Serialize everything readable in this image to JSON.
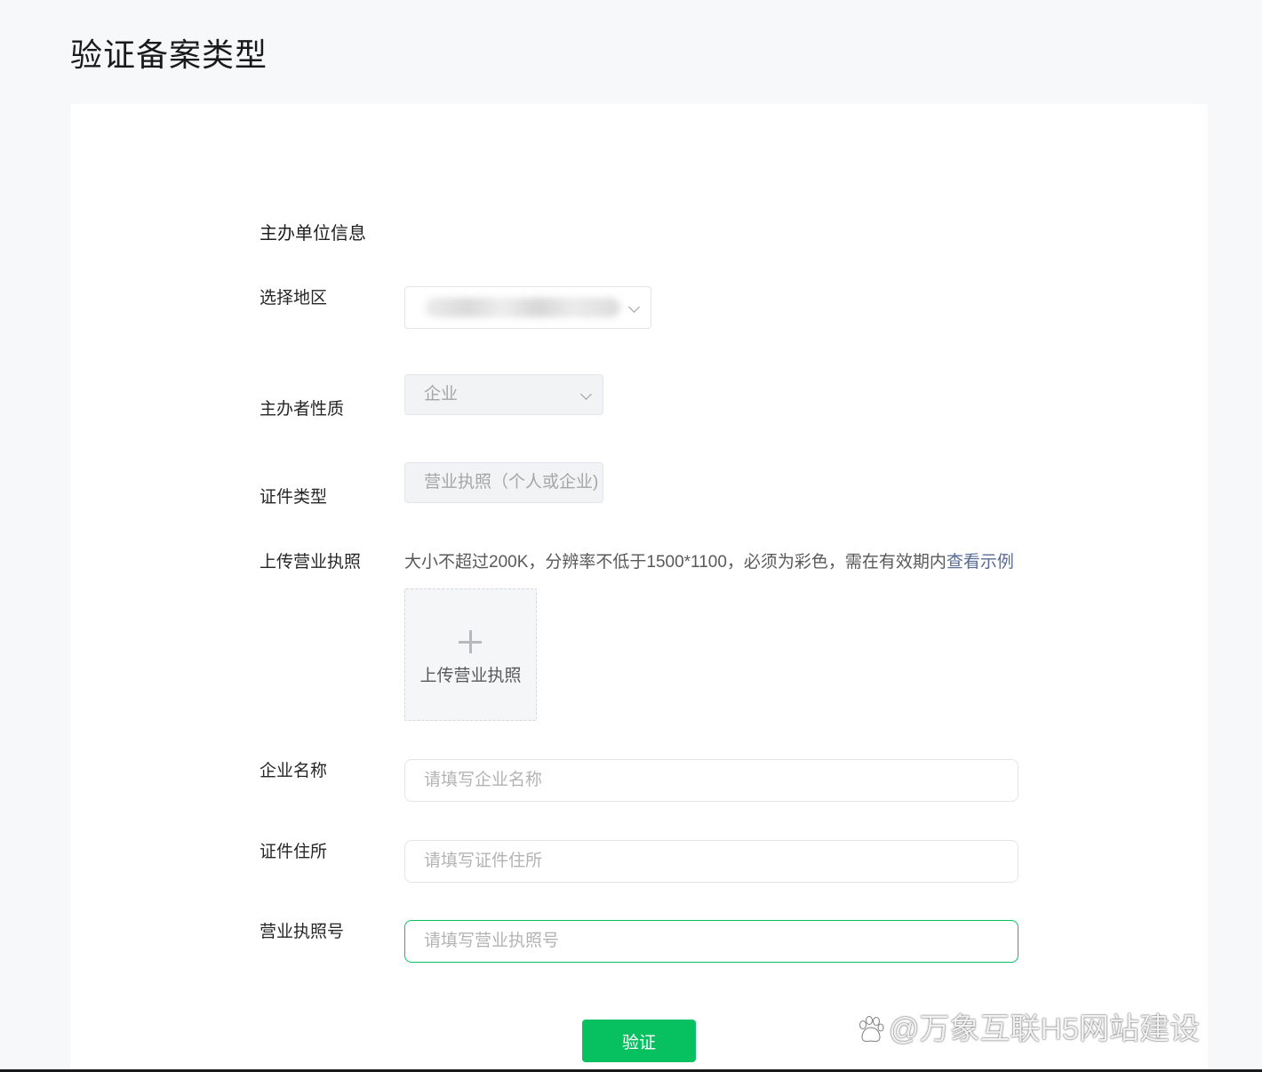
{
  "page": {
    "title": "验证备案类型"
  },
  "form": {
    "section_title": "主办单位信息",
    "region": {
      "label": "选择地区"
    },
    "sponsor_nature": {
      "label": "主办者性质",
      "value": "企业"
    },
    "cert_type": {
      "label": "证件类型",
      "value": "营业执照（个人或企业)"
    },
    "license_upload": {
      "label": "上传营业执照",
      "hint": "大小不超过200K，分辨率不低于1500*1100，必须为彩色，需在有效期内",
      "example_link": "查看示例",
      "button_label": "上传营业执照"
    },
    "company_name": {
      "label": "企业名称",
      "placeholder": "请填写企业名称"
    },
    "cert_address": {
      "label": "证件住所",
      "placeholder": "请填写证件住所"
    },
    "license_number": {
      "label": "营业执照号",
      "placeholder": "请填写营业执照号"
    },
    "submit_label": "验证"
  },
  "watermark": {
    "text": "@万象互联H5网站建设"
  },
  "colors": {
    "accent": "#07c160",
    "link": "#576b95",
    "background": "#f7f8fa"
  }
}
